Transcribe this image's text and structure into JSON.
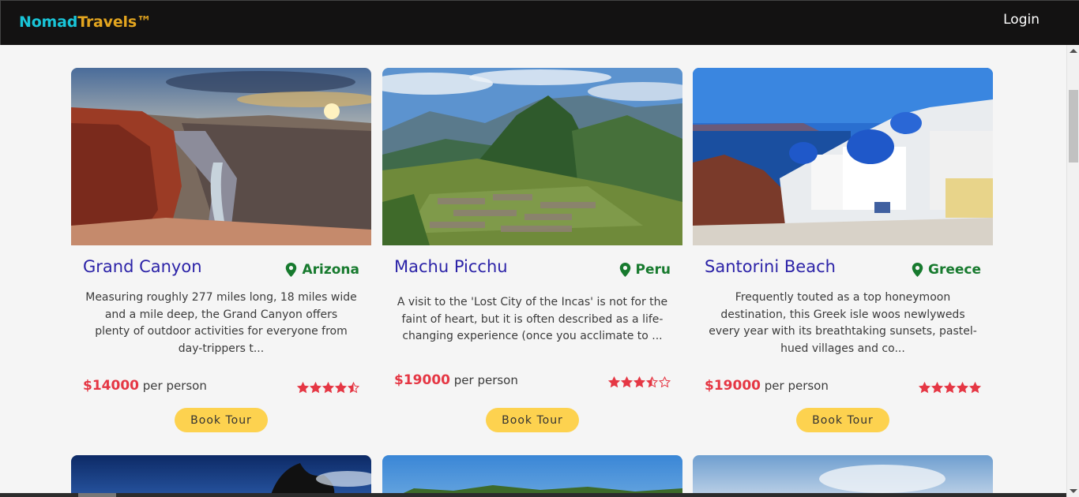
{
  "header": {
    "brand_part1": "Nomad",
    "brand_part2": "Travels™",
    "login_label": "Login"
  },
  "colors": {
    "topbar_bg": "#131212",
    "brand_cyan": "#19c5d8",
    "brand_orange": "#e3a51f",
    "title": "#2c23a8",
    "location": "#177a2e",
    "price": "#e53744",
    "button": "#fdd24f",
    "star": "#e53744"
  },
  "tours": [
    {
      "name": "Grand Canyon",
      "location": "Arizona",
      "description_lines": [
        "Measuring roughly 277 miles long, 18 miles wide",
        "and a mile deep, the Grand Canyon offers",
        "plenty of outdoor activities for everyone from",
        "day-trippers t..."
      ],
      "price": "$14000",
      "per_person": "per person",
      "rating": 4.5,
      "button_label": "Book Tour",
      "image": "grand-canyon-photo"
    },
    {
      "name": "Machu Picchu",
      "location": "Peru",
      "description_lines": [
        "A visit to the 'Lost City of the Incas' is not for the",
        "faint of heart, but it is often described as a life-",
        "changing experience (once you acclimate to ..."
      ],
      "price": "$19000",
      "per_person": "per person",
      "rating": 3.5,
      "button_label": "Book Tour",
      "image": "machu-picchu-photo"
    },
    {
      "name": "Santorini Beach",
      "location": "Greece",
      "description_lines": [
        "Frequently touted as a top honeymoon",
        "destination, this Greek isle woos newlyweds",
        "every year with its breathtaking sunsets, pastel-",
        "hued villages and co..."
      ],
      "price": "$19000",
      "per_person": "per person",
      "rating": 5,
      "button_label": "Book Tour",
      "image": "santorini-photo"
    }
  ]
}
